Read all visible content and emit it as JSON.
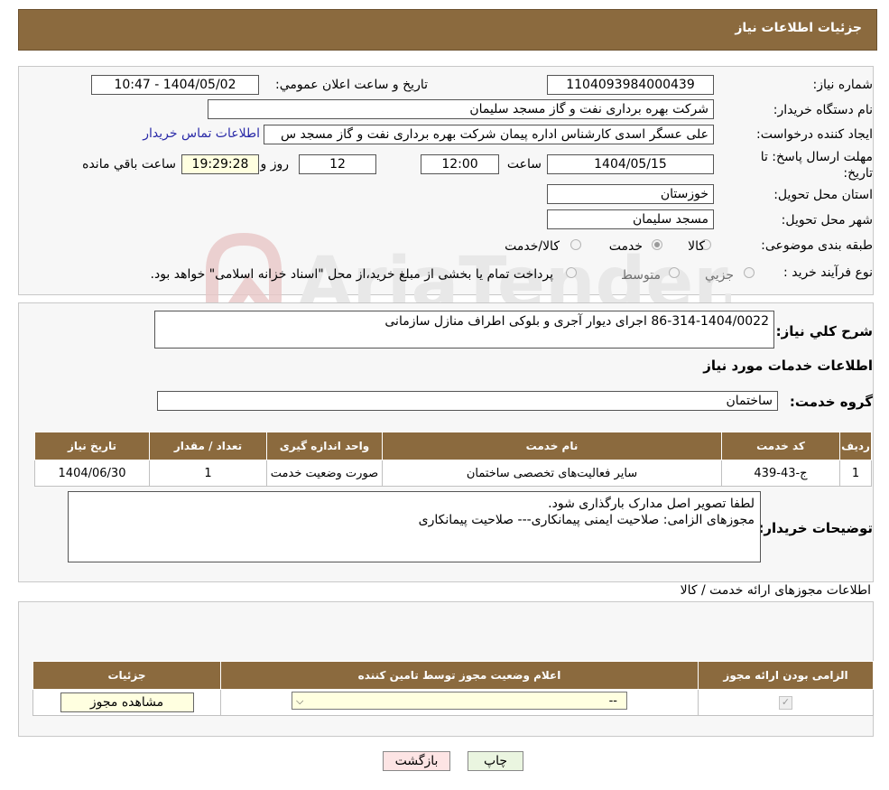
{
  "header": {
    "title": "جزئیات اطلاعات نیاز"
  },
  "info": {
    "need_number_label": "شماره نیاز:",
    "need_number": "1104093984000439",
    "announce_label": "تاریخ و ساعت اعلان عمومي:",
    "announce_value": "1404/05/02 - 10:47",
    "buyer_org_label": "نام دستگاه خريدار:",
    "buyer_org": "شرکت بهره برداری نفت و گاز مسجد سلیمان",
    "creator_label": "ايجاد کننده درخواست:",
    "creator": "علی عسگر اسدی کارشناس اداره پیمان  شرکت بهره برداری نفت و گاز مسجد س",
    "contact_link": "اطلاعات تماس خريدار",
    "deadline_label": "مهلت ارسال پاسخ: تا تاريخ:",
    "deadline_date": "1404/05/15",
    "hour_label": "ساعت",
    "deadline_time": "12:00",
    "days": "12",
    "days_label": "روز و",
    "remaining_time": "19:29:28",
    "remaining_label": "ساعت باقي مانده",
    "province_label": "استان محل تحويل:",
    "province": "خوزستان",
    "city_label": "شهر محل تحويل:",
    "city": "مسجد سلیمان",
    "category_label": "طبقه بندی موضوعی:",
    "category_options": [
      "کالا",
      "خدمت",
      "کالا/خدمت"
    ],
    "category_selected": "خدمت",
    "process_label": "نوع فرآيند خريد :",
    "process_options": [
      "جزيي",
      "متوسط"
    ],
    "process_note": "پرداخت تمام يا بخشی از مبلغ خريد،از محل \"اسناد خزانه اسلامی\" خواهد بود."
  },
  "summary": {
    "label": "شرح كلي نياز:",
    "value": "86-314-1404/0022 اجرای دیوار آجری و بلوکی اطراف منازل سازمانی"
  },
  "services": {
    "section_title": "اطلاعات خدمات مورد نياز",
    "group_label": "گروه خدمت:",
    "group_value": "ساختمان",
    "columns": [
      "رديف",
      "کد خدمت",
      "نام خدمت",
      "واحد اندازه گيری",
      "تعداد / مقدار",
      "تاريخ نياز"
    ],
    "rows": [
      [
        "1",
        "ج-43-439",
        "سایر فعالیت‌های تخصصی ساختمان",
        "صورت وضعیت خدمت",
        "1",
        "1404/06/30"
      ]
    ]
  },
  "buyer_notes": {
    "label": "توضيحات خريدار:",
    "line1": "لطفا تصویر اصل مدارک بارگذاری شود.",
    "line2": "مجوزهای الزامی: صلاحیت ایمنی پیمانکاری--- صلاحیت پیمانکاری"
  },
  "permits": {
    "section_title": "اطلاعات مجوزهای ارائه خدمت / کالا",
    "columns": [
      "الزامی بودن ارائه مجوز",
      "اعلام وضعيت مجوز توسط تامين کننده",
      "جزئيات"
    ],
    "select_value": "--",
    "view_button": "مشاهده مجوز"
  },
  "actions": {
    "print": "چاپ",
    "back": "بازگشت"
  },
  "watermark": {
    "text": "AriaTender.neT"
  },
  "colors": {
    "header": "#8b6a3e",
    "link": "#2a2aa8",
    "back_button": "#fde4e4",
    "print_button": "#eaf5e0"
  }
}
